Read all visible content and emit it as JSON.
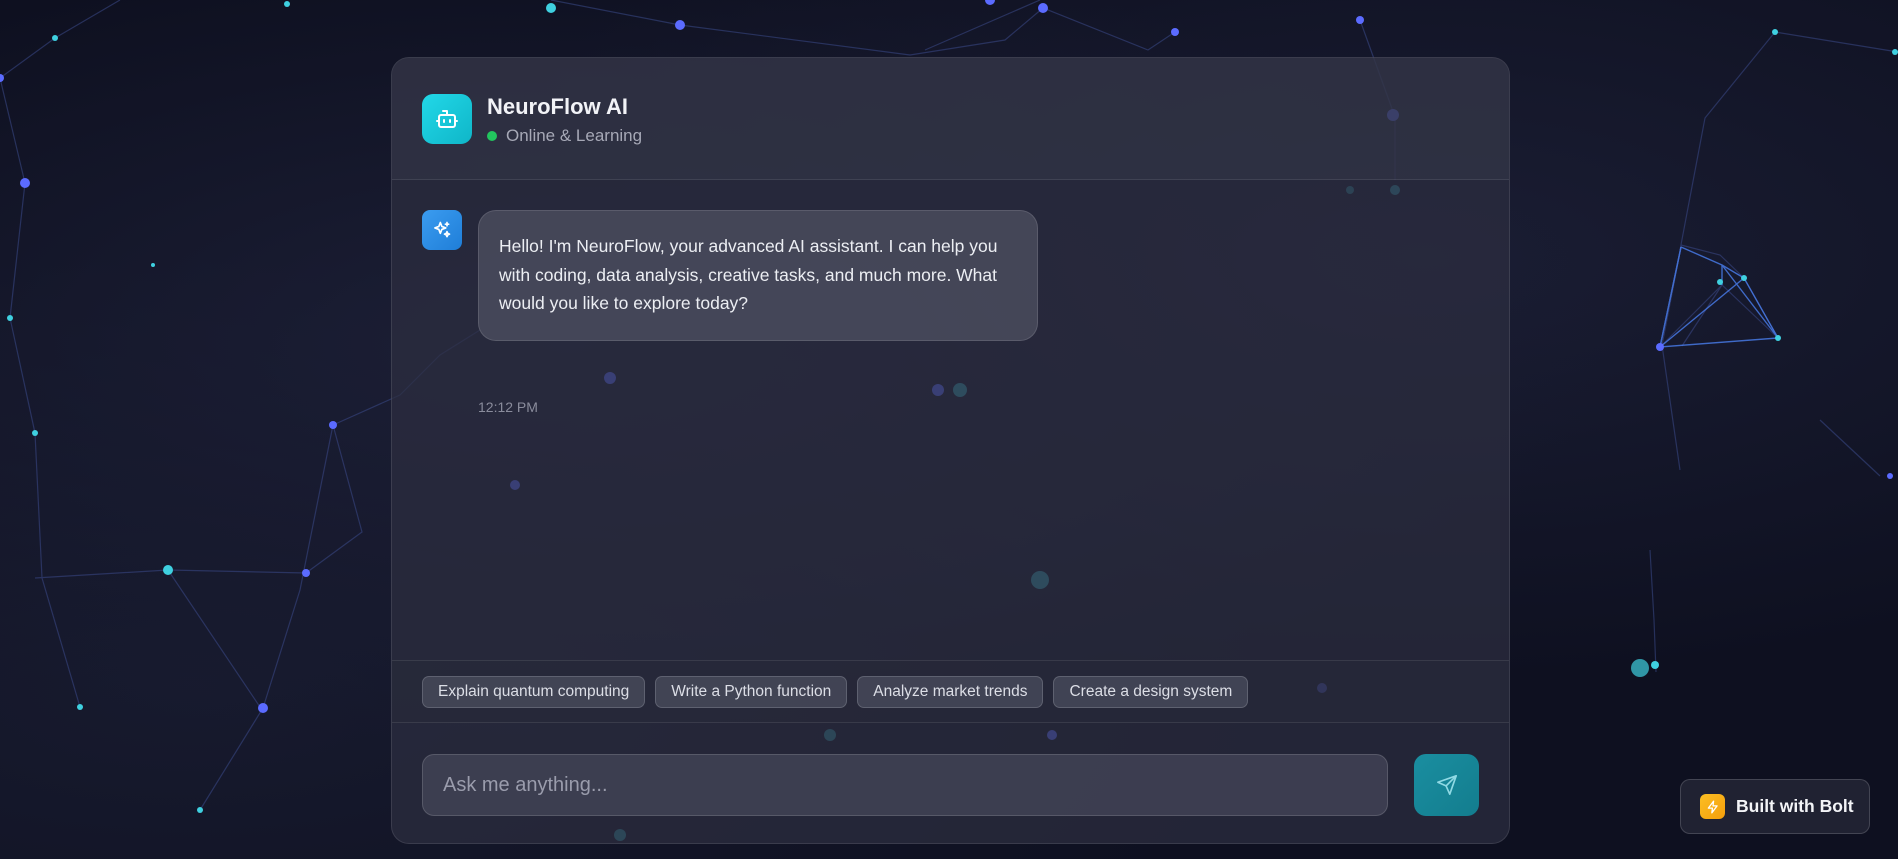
{
  "header": {
    "title": "NeuroFlow AI",
    "status": "Online & Learning",
    "avatar_icon": "robot-icon"
  },
  "messages": [
    {
      "sender": "assistant",
      "avatar_icon": "sparkles-icon",
      "text": "Hello! I'm NeuroFlow, your advanced AI assistant. I can help you with coding, data analysis, creative tasks, and much more. What would you like to explore today?",
      "time": "12:12 PM"
    }
  ],
  "suggestions": [
    "Explain quantum computing",
    "Write a Python function",
    "Analyze market trends",
    "Create a design system"
  ],
  "input": {
    "placeholder": "Ask me anything...",
    "value": ""
  },
  "send_icon": "send-icon",
  "badge": {
    "label": "Built with Bolt",
    "icon": "lightning-icon"
  },
  "colors": {
    "accent": "#22d8e8",
    "status_online": "#22c55e",
    "send_button": "#1a8ea0",
    "bolt": "#f59e0b"
  }
}
